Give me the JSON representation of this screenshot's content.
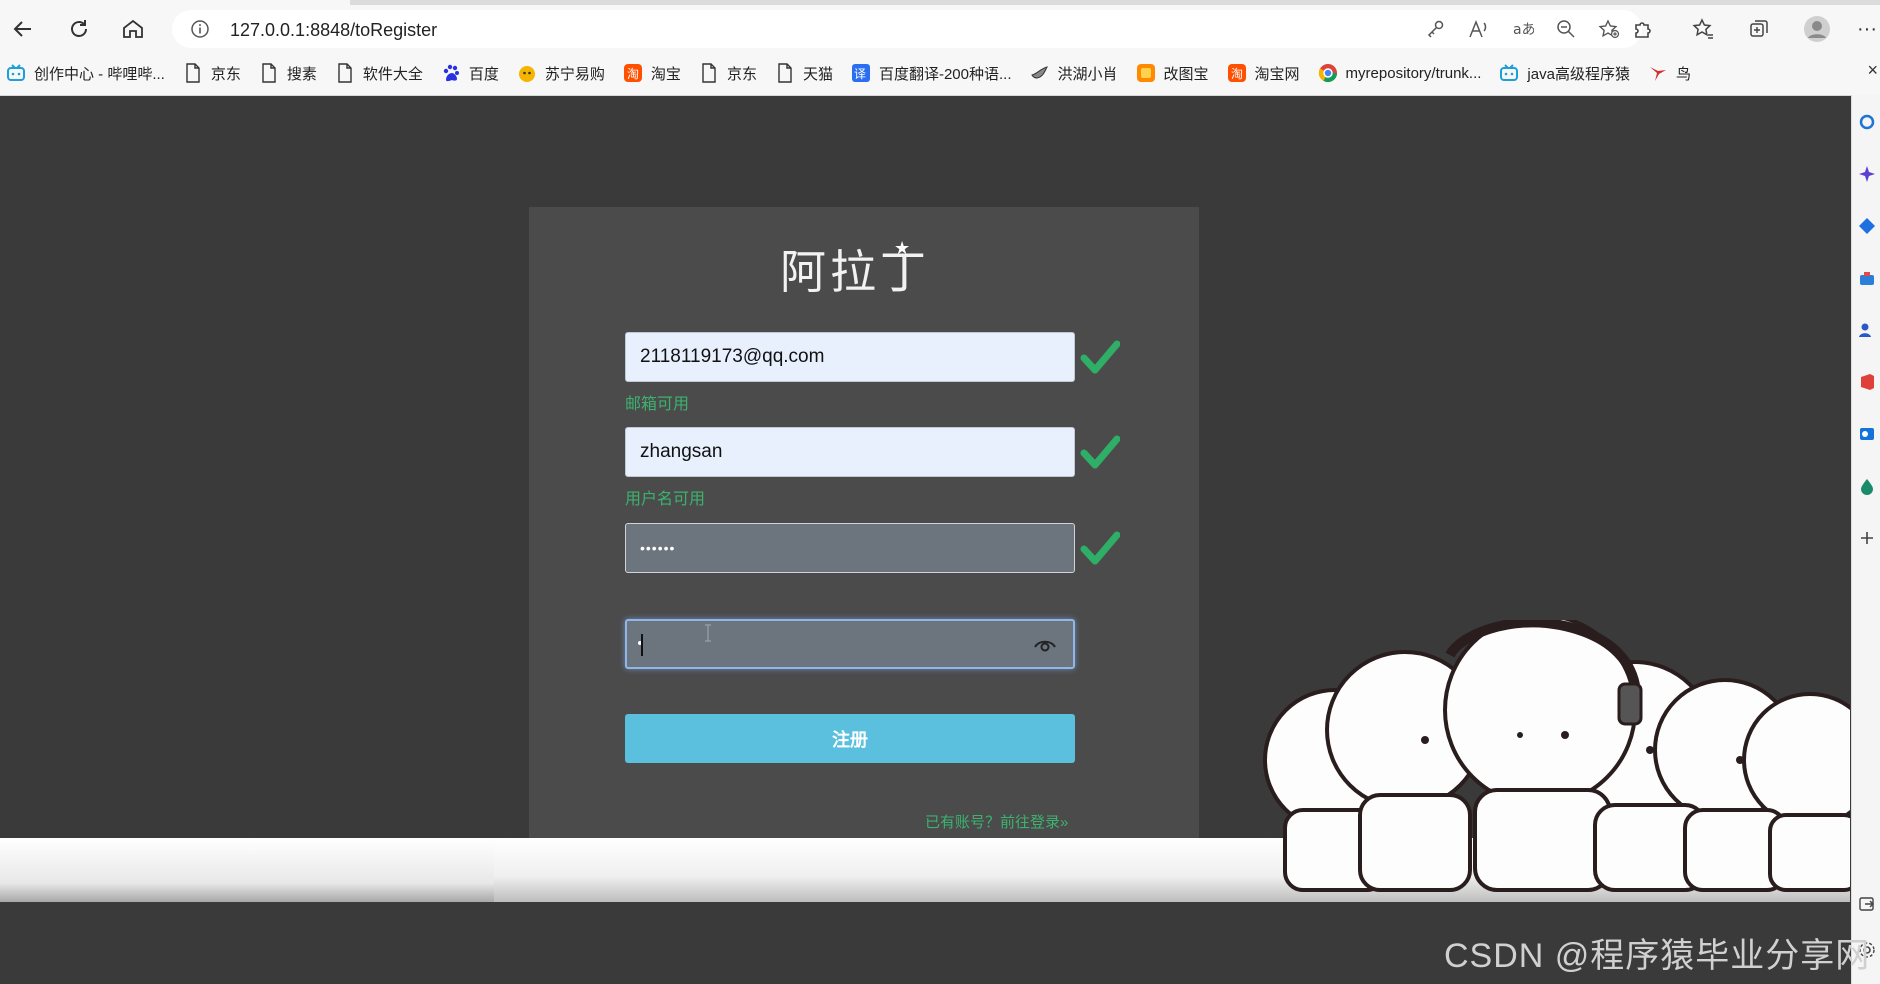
{
  "browser": {
    "url": "127.0.0.1:8848/toRegister",
    "bookmarks": [
      {
        "label": "创作中心 - 哔哩哔...",
        "icon": "bilibili-icon"
      },
      {
        "label": "京东",
        "icon": "page-icon"
      },
      {
        "label": "搜素",
        "icon": "page-icon"
      },
      {
        "label": "软件大全",
        "icon": "page-icon"
      },
      {
        "label": "百度",
        "icon": "baidu-paw-icon"
      },
      {
        "label": "苏宁易购",
        "icon": "suning-icon"
      },
      {
        "label": "淘宝",
        "icon": "taobao-icon"
      },
      {
        "label": "京东",
        "icon": "page-icon"
      },
      {
        "label": "天猫",
        "icon": "page-icon"
      },
      {
        "label": "百度翻译-200种语...",
        "icon": "translate-icon"
      },
      {
        "label": "洪湖小肖",
        "icon": "bird-icon"
      },
      {
        "label": "改图宝",
        "icon": "gaitubao-icon"
      },
      {
        "label": "淘宝网",
        "icon": "taobao-icon"
      },
      {
        "label": "myrepository/trunk...",
        "icon": "chrome-icon"
      },
      {
        "label": "java高级程序猿",
        "icon": "bilibili-icon"
      },
      {
        "label": "鸟",
        "icon": "swallow-icon"
      }
    ],
    "bookmarks_close": "×"
  },
  "form": {
    "logo_text": "阿拉丁",
    "email_value": "2118119173@qq.com",
    "email_hint": "邮箱可用",
    "username_value": "zhangsan",
    "username_hint": "用户名可用",
    "password_mask": "••••••",
    "submit_label": "注册",
    "login_link": "已有账号？前往登录»"
  },
  "colors": {
    "accent": "#5bc0de",
    "success": "#3bb36f",
    "background": "#3a3a3a",
    "card": "#4b4b4b"
  },
  "watermark": "CSDN @程序猿毕业分享网"
}
